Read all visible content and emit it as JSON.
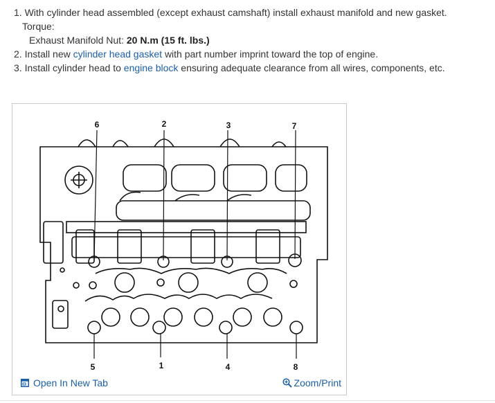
{
  "instructions": {
    "step1_num": "1.",
    "step1_text": "With cylinder head assembled (except exhaust camshaft) install exhaust manifold and new gasket.",
    "torque_label": "Torque:",
    "torque_item_label": "Exhaust Manifold Nut:",
    "torque_item_value": "20 N.m (15 ft. lbs.)",
    "step2_num": "2.",
    "step2_pre": "Install new",
    "step2_link": "cylinder head gasket",
    "step2_post": "with part number imprint toward the top of engine.",
    "step3_num": "3.",
    "step3_pre": "Install cylinder head to",
    "step3_link": "engine block",
    "step3_post": "ensuring adequate clearance from all wires, components, etc."
  },
  "figure": {
    "callouts_top": [
      "6",
      "2",
      "3",
      "7"
    ],
    "callouts_bottom": [
      "5",
      "1",
      "4",
      "8"
    ],
    "open_tab_label": "Open In New Tab",
    "open_tab_icon": "open-in-new-tab-icon",
    "zoom_label": "Zoom/Print",
    "zoom_icon": "zoom-magnifier-icon"
  },
  "colors": {
    "link": "#1a5fa8",
    "text": "#333333",
    "border": "#c9c9c9"
  }
}
